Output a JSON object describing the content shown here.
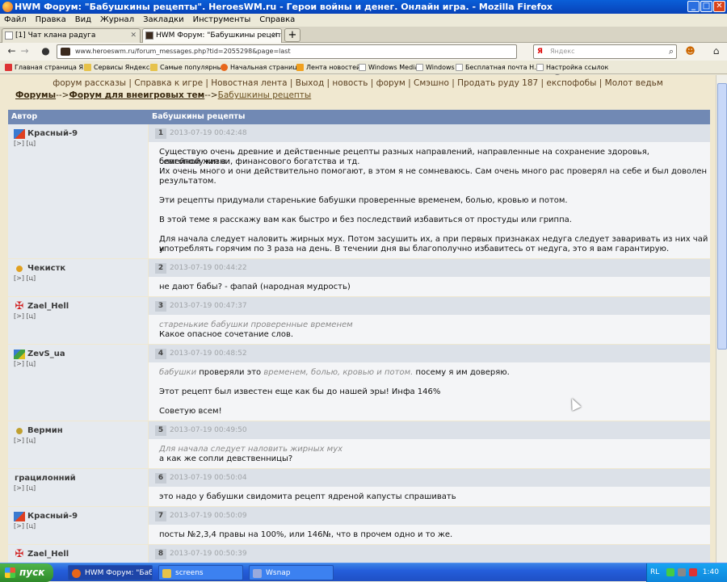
{
  "window": {
    "title": "HWM Форум: \"Бабушкины рецепты\". HeroesWM.ru - Герои войны и денег. Онлайн игра. - Mozilla Firefox"
  },
  "menu": [
    "Файл",
    "Правка",
    "Вид",
    "Журнал",
    "Закладки",
    "Инструменты",
    "Справка"
  ],
  "tabs": [
    {
      "label": "[1] Чат клана радуга",
      "active": false
    },
    {
      "label": "HWM Форум: \"Бабушкины рецепты\". Н...",
      "active": true
    }
  ],
  "nav": {
    "url": "www.heroeswm.ru/forum_messages.php?tid=2055298&page=last",
    "search_placeholder": "Яндекс"
  },
  "bookmarks": [
    "Главная страница Я...",
    "Сервисы Яндекса",
    "Самые популярные",
    "Начальная страница",
    "Лента новостей",
    "Windows Media",
    "Windows",
    "Бесплатная почта Н...",
    "Настройка ссылок"
  ],
  "forum_links": "форум рассказы | Справка к игре | Новостная лента | Выход | новость | форум | Смэшно | Продать руду 187 | експофобы | Молот ведьм",
  "breadcrumb": {
    "root": "Форумы",
    "section": "Форум для внеигровых тем",
    "topic": "Бабушкины рецепты",
    "sep": "-->"
  },
  "table_head": {
    "author": "Автор",
    "topic": "Бабушкины рецепты"
  },
  "author_links": "[>] [ц]",
  "posts": [
    {
      "num": "1",
      "author": "Красный-9",
      "date": "2013-07-19 00:42:48",
      "lines": [
        "Существую очень древние и действенные рецепты разных направлений, направленные на сохранение здоровья, благополучия в",
        "семейной жизни, финансового богатства и тд.",
        "Их очень много и они действительно помогают, в этом я не сомневаюсь. Сам очень много рас проверял на себе и был доволен",
        "результатом.",
        "",
        "Эти рецепты придумали старенькие бабушки проверенные временем, болью, кровью и потом.",
        "",
        "В этой теме я расскажу вам как быстро и без последствий избавиться от простуды или гриппа.",
        "",
        "Для начала следует наловить жирных мух. Потом засушить их, а при первых признаках недуга следует заваривать из них чай и",
        "употреблять горячим по 3 раза на день. В течении дня вы благополучно избавитесь от недуга, это я вам гарантирую."
      ]
    },
    {
      "num": "2",
      "author": "Чекистк",
      "date": "2013-07-19 00:44:22",
      "lines": [
        "не дают бабы? - фапай (народная мудрость)"
      ]
    },
    {
      "num": "3",
      "author": "Zael_Hell",
      "date": "2013-07-19 00:47:37",
      "quote": "старенькие бабушки проверенные временем",
      "lines": [
        "Какое опасное сочетание слов."
      ]
    },
    {
      "num": "4",
      "author": "ZevS_ua",
      "date": "2013-07-19 00:48:52",
      "mixed": {
        "q1": "бабушки",
        "t1": " проверяли это ",
        "q2": "временем, болью, кровью и потом.",
        "t2": " посему я им доверяю."
      },
      "lines": [
        "Этот рецепт был известен еще как бы до нашей эры! Инфа 146%",
        "",
        "Советую всем!"
      ]
    },
    {
      "num": "5",
      "author": "Вермин",
      "date": "2013-07-19 00:49:50",
      "quote": "Для начала следует наловить жирных мух",
      "lines": [
        "а как же сопли девственницы?"
      ]
    },
    {
      "num": "6",
      "author": "грацилонний",
      "date": "2013-07-19 00:50:04",
      "lines": [
        "это надо у бабушки свидомита рецепт ядреной капусты спрашивать"
      ]
    },
    {
      "num": "7",
      "author": "Красный-9",
      "date": "2013-07-19 00:50:09",
      "lines": [
        "посты №2,3,4 правы на 100%, или 146№, что в прочем одно и то же."
      ]
    },
    {
      "num": "8",
      "author": "Zael_Hell",
      "date": "2013-07-19 00:50:39",
      "lines": []
    }
  ],
  "taskbar": {
    "start": "пуск",
    "tasks": [
      "HWM Форум: \"Бабушк...",
      "screens",
      "Wsnap"
    ],
    "lang": "RL",
    "clock": "1:40"
  }
}
